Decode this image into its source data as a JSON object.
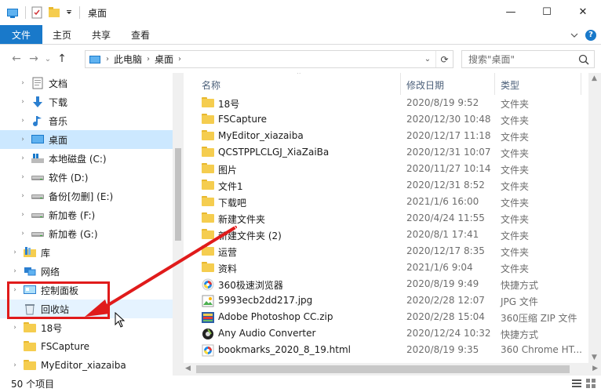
{
  "window": {
    "title": "桌面",
    "controls": {
      "minimize": "—",
      "maximize": "☐",
      "close": "✕"
    }
  },
  "ribbon": {
    "tabs": [
      {
        "label": "文件",
        "active": true
      },
      {
        "label": "主页",
        "active": false
      },
      {
        "label": "共享",
        "active": false
      },
      {
        "label": "查看",
        "active": false
      }
    ],
    "collapse_icon": "chevron-down-icon",
    "help_label": "?"
  },
  "address": {
    "back": "←",
    "forward": "→",
    "recent": "⌄",
    "up": "↑",
    "crumbs": [
      "此电脑",
      "桌面"
    ],
    "refresh": "⟳",
    "search_placeholder": "搜索\"桌面\""
  },
  "nav": {
    "items": [
      {
        "label": "文档",
        "icon": "documents-icon",
        "level": 1,
        "chevron": "›"
      },
      {
        "label": "下载",
        "icon": "download-icon",
        "level": 1,
        "chevron": "›"
      },
      {
        "label": "音乐",
        "icon": "music-icon",
        "level": 1,
        "chevron": "›"
      },
      {
        "label": "桌面",
        "icon": "desktop-icon",
        "level": 1,
        "chevron": "›",
        "selected": true
      },
      {
        "label": "本地磁盘 (C:)",
        "icon": "windows-drive-icon",
        "level": 1,
        "chevron": "›"
      },
      {
        "label": "软件 (D:)",
        "icon": "drive-icon",
        "level": 1,
        "chevron": "›"
      },
      {
        "label": "备份[勿删] (E:)",
        "icon": "drive-icon",
        "level": 1,
        "chevron": "›"
      },
      {
        "label": "新加卷 (F:)",
        "icon": "drive-icon",
        "level": 1,
        "chevron": "›"
      },
      {
        "label": "新加卷 (G:)",
        "icon": "drive-icon",
        "level": 1,
        "chevron": "›"
      },
      {
        "label": "库",
        "icon": "library-icon",
        "level": 0,
        "chevron": "›"
      },
      {
        "label": "网络",
        "icon": "network-icon",
        "level": 0,
        "chevron": "›"
      },
      {
        "label": "控制面板",
        "icon": "control-panel-icon",
        "level": 0,
        "chevron": "›"
      },
      {
        "label": "回收站",
        "icon": "recycle-bin-icon",
        "level": 0,
        "chevron": "",
        "hover": true
      },
      {
        "label": "18号",
        "icon": "folder-icon",
        "level": 0,
        "chevron": "›"
      },
      {
        "label": "FSCapture",
        "icon": "folder-icon",
        "level": 0,
        "chevron": ""
      },
      {
        "label": "MyEditor_xiazaiba",
        "icon": "folder-icon",
        "level": 0,
        "chevron": "›"
      }
    ]
  },
  "columns": {
    "name": "名称",
    "date": "修改日期",
    "type": "类型"
  },
  "files": [
    {
      "name": "18号",
      "date": "2020/8/19 9:52",
      "type": "文件夹",
      "icon": "folder-icon"
    },
    {
      "name": "FSCapture",
      "date": "2020/12/30 10:48",
      "type": "文件夹",
      "icon": "folder-icon"
    },
    {
      "name": "MyEditor_xiazaiba",
      "date": "2020/12/17 11:18",
      "type": "文件夹",
      "icon": "folder-icon"
    },
    {
      "name": "QCSTPPLCLGJ_XiaZaiBa",
      "date": "2020/12/31 10:07",
      "type": "文件夹",
      "icon": "folder-icon"
    },
    {
      "name": "图片",
      "date": "2020/11/27 10:14",
      "type": "文件夹",
      "icon": "folder-icon"
    },
    {
      "name": "文件1",
      "date": "2020/12/31 8:52",
      "type": "文件夹",
      "icon": "folder-icon"
    },
    {
      "name": "下载吧",
      "date": "2021/1/6 16:00",
      "type": "文件夹",
      "icon": "folder-icon"
    },
    {
      "name": "新建文件夹",
      "date": "2020/4/24 11:55",
      "type": "文件夹",
      "icon": "folder-icon"
    },
    {
      "name": "新建文件夹 (2)",
      "date": "2020/8/1 17:41",
      "type": "文件夹",
      "icon": "folder-icon"
    },
    {
      "name": "运营",
      "date": "2020/12/17 8:35",
      "type": "文件夹",
      "icon": "folder-icon"
    },
    {
      "name": "资料",
      "date": "2021/1/6 9:04",
      "type": "文件夹",
      "icon": "folder-icon"
    },
    {
      "name": "360极速浏览器",
      "date": "2020/8/19 9:49",
      "type": "快捷方式",
      "icon": "browser-shortcut-icon"
    },
    {
      "name": "5993ecb2dd217.jpg",
      "date": "2020/2/28 12:07",
      "type": "JPG 文件",
      "icon": "image-file-icon"
    },
    {
      "name": "Adobe Photoshop CC.zip",
      "date": "2020/2/28 15:04",
      "type": "360压缩 ZIP 文件",
      "icon": "zip-file-icon"
    },
    {
      "name": "Any Audio Converter",
      "date": "2020/12/24 10:32",
      "type": "快捷方式",
      "icon": "audio-app-icon"
    },
    {
      "name": "bookmarks_2020_8_19.html",
      "date": "2020/8/19 9:35",
      "type": "360 Chrome HT...",
      "icon": "html-file-icon"
    }
  ],
  "status": {
    "count_text": "50 个项目"
  },
  "colors": {
    "accent": "#1979ca",
    "selected_bg": "#cce8ff",
    "annotation": "#e01b1b",
    "folder": "#f5cd4f"
  }
}
